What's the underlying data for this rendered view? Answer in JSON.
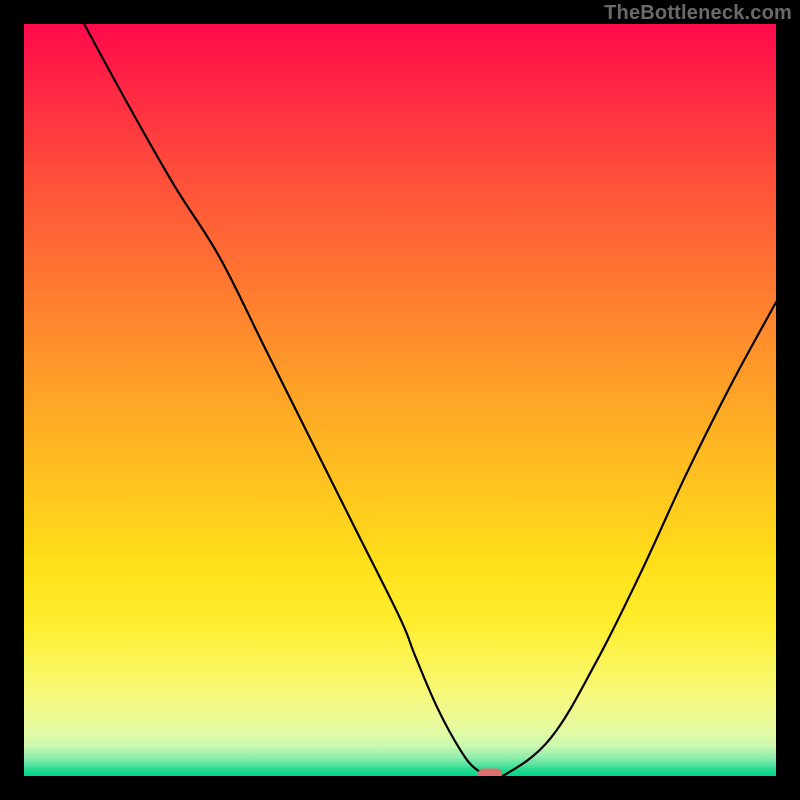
{
  "watermark": "TheBottleneck.com",
  "chart_data": {
    "type": "line",
    "title": "",
    "xlabel": "",
    "ylabel": "",
    "xlim": [
      0,
      100
    ],
    "ylim": [
      0,
      100
    ],
    "grid": false,
    "x": [
      8,
      14,
      20,
      26,
      32,
      38,
      44,
      50,
      52,
      55,
      58,
      60,
      62,
      64,
      70,
      76,
      82,
      88,
      94,
      100
    ],
    "values": [
      100,
      89,
      78.5,
      69,
      57,
      45,
      33,
      21,
      16,
      9,
      3.5,
      1,
      0.2,
      0.2,
      5,
      15,
      27,
      40,
      52,
      63
    ],
    "marker": {
      "x": 62,
      "y": 0.2,
      "color": "#e07070"
    },
    "line_color": "#000000",
    "line_width": 2.2,
    "background_gradient_stops": [
      {
        "pos": 0,
        "color": "#ff0a4a"
      },
      {
        "pos": 14,
        "color": "#ff3a3f"
      },
      {
        "pos": 36,
        "color": "#ff7c30"
      },
      {
        "pos": 60,
        "color": "#ffc020"
      },
      {
        "pos": 87,
        "color": "#f9f768"
      },
      {
        "pos": 96,
        "color": "#c9f9ae"
      },
      {
        "pos": 100,
        "color": "#02d789"
      }
    ]
  }
}
